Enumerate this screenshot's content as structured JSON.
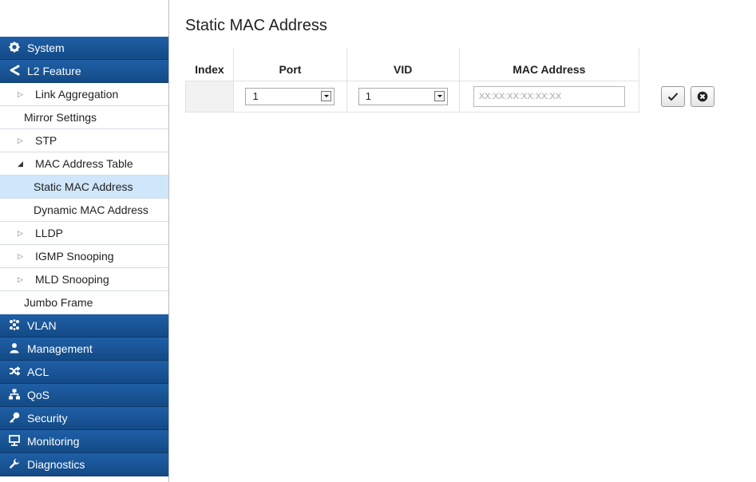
{
  "sidebar": {
    "items": [
      {
        "label": "System",
        "kind": "cat",
        "icon": "gear-icon"
      },
      {
        "label": "L2 Feature",
        "kind": "cat",
        "icon": "share-icon"
      },
      {
        "label": "Link Aggregation",
        "kind": "sub",
        "marker": "collapsed"
      },
      {
        "label": "Mirror Settings",
        "kind": "sub",
        "marker": "none"
      },
      {
        "label": "STP",
        "kind": "sub",
        "marker": "collapsed"
      },
      {
        "label": "MAC Address Table",
        "kind": "sub",
        "marker": "expanded"
      },
      {
        "label": "Static MAC Address",
        "kind": "leaf",
        "active": true
      },
      {
        "label": "Dynamic MAC Address",
        "kind": "leaf"
      },
      {
        "label": "LLDP",
        "kind": "sub",
        "marker": "collapsed"
      },
      {
        "label": "IGMP Snooping",
        "kind": "sub",
        "marker": "collapsed"
      },
      {
        "label": "MLD Snooping",
        "kind": "sub",
        "marker": "collapsed"
      },
      {
        "label": "Jumbo Frame",
        "kind": "sub",
        "marker": "none"
      },
      {
        "label": "VLAN",
        "kind": "cat",
        "icon": "cluster-icon"
      },
      {
        "label": "Management",
        "kind": "cat",
        "icon": "user-icon"
      },
      {
        "label": "ACL",
        "kind": "cat",
        "icon": "shuffle-icon"
      },
      {
        "label": "QoS",
        "kind": "cat",
        "icon": "sitemap-icon"
      },
      {
        "label": "Security",
        "kind": "cat",
        "icon": "key-icon"
      },
      {
        "label": "Monitoring",
        "kind": "cat",
        "icon": "monitor-icon"
      },
      {
        "label": "Diagnostics",
        "kind": "cat",
        "icon": "wrench-icon"
      }
    ]
  },
  "main": {
    "title": "Static MAC Address",
    "table": {
      "headers": {
        "index": "Index",
        "port": "Port",
        "vid": "VID",
        "mac": "MAC Address"
      },
      "row": {
        "port_value": "1",
        "vid_value": "1",
        "mac_placeholder": "XX:XX:XX:XX:XX:XX"
      }
    }
  },
  "colors": {
    "nav_category_bg": "#134a86",
    "nav_active_bg": "#cfe6fb"
  }
}
